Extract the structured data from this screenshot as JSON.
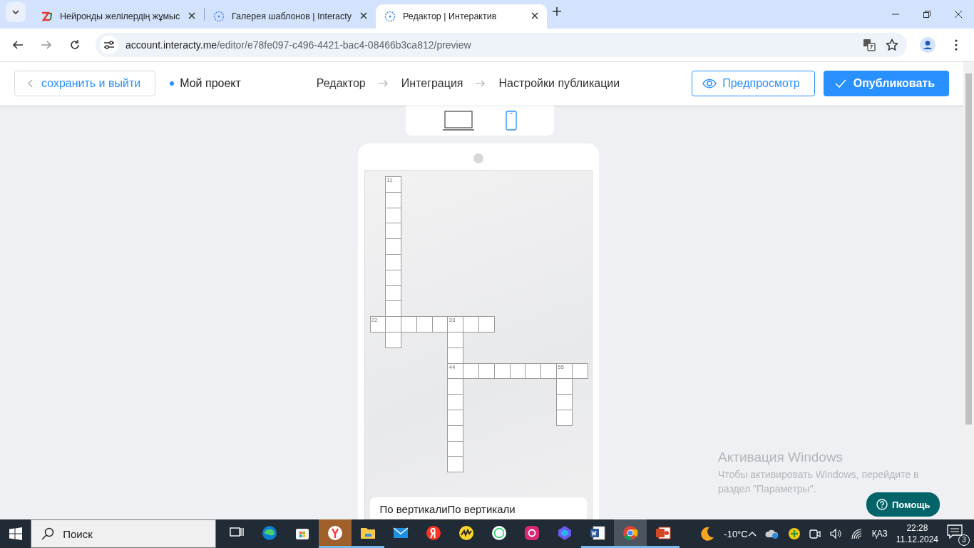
{
  "browser": {
    "tabs": [
      {
        "title": "Нейронды желілердің жұмыс",
        "kind": "z",
        "selected": false
      },
      {
        "title": "Галерея шаблонов | Interacty",
        "kind": "spinner",
        "selected": false
      },
      {
        "title": "Редактор | Интерактив",
        "kind": "spinner",
        "selected": true
      }
    ],
    "url_host": "account.interacty.me",
    "url_path": "/editor/e78fe097-c496-4421-bac4-08466b3ca812/preview"
  },
  "header": {
    "back_button": "сохранить и выйти",
    "project": "Мой проект",
    "steps": [
      {
        "label": "Редактор"
      },
      {
        "label": "Интеграция"
      },
      {
        "label": "Настройки публикации"
      }
    ],
    "preview_button": "Предпросмотр",
    "publish_button": "Опубликовать"
  },
  "device_toggle": [
    {
      "kind": "desktop",
      "selected": false
    },
    {
      "kind": "mobile",
      "selected": true
    }
  ],
  "crossword": {
    "words": [
      {
        "number": "11"
      },
      {
        "number": "22"
      },
      {
        "number": "33"
      },
      {
        "number": "44"
      },
      {
        "number": "55"
      }
    ]
  },
  "clues_heading": "По вертикалиПо вертикали",
  "activation": {
    "title": "Активация Windows",
    "text": "Чтобы активировать Windows, перейдите в раздел \"Параметры\"."
  },
  "help_button": "Помощь",
  "taskbar": {
    "search_placeholder": "Поиск",
    "apps": [
      {
        "kind": "taskview",
        "active": false,
        "running": false
      },
      {
        "kind": "edge",
        "active": false,
        "running": false
      },
      {
        "kind": "store",
        "active": false,
        "running": false
      },
      {
        "kind": "yandex-browser",
        "active": true,
        "running": true
      },
      {
        "kind": "explorer",
        "active": false,
        "running": true
      },
      {
        "kind": "mail",
        "active": false,
        "running": false
      },
      {
        "kind": "yandex",
        "active": false,
        "running": false
      },
      {
        "kind": "music",
        "active": false,
        "running": false
      },
      {
        "kind": "whatsapp",
        "active": false,
        "running": false
      },
      {
        "kind": "instagram",
        "active": false,
        "running": false
      },
      {
        "kind": "copilot",
        "active": false,
        "running": false
      },
      {
        "kind": "word",
        "active": false,
        "running": true
      },
      {
        "kind": "chrome",
        "active": true,
        "running": true
      },
      {
        "kind": "powerpoint",
        "active": false,
        "running": true
      }
    ],
    "weather": "-10°C",
    "language": "ҚАЗ",
    "time": "22:28",
    "date": "11.12.2024",
    "notifications": "3"
  }
}
